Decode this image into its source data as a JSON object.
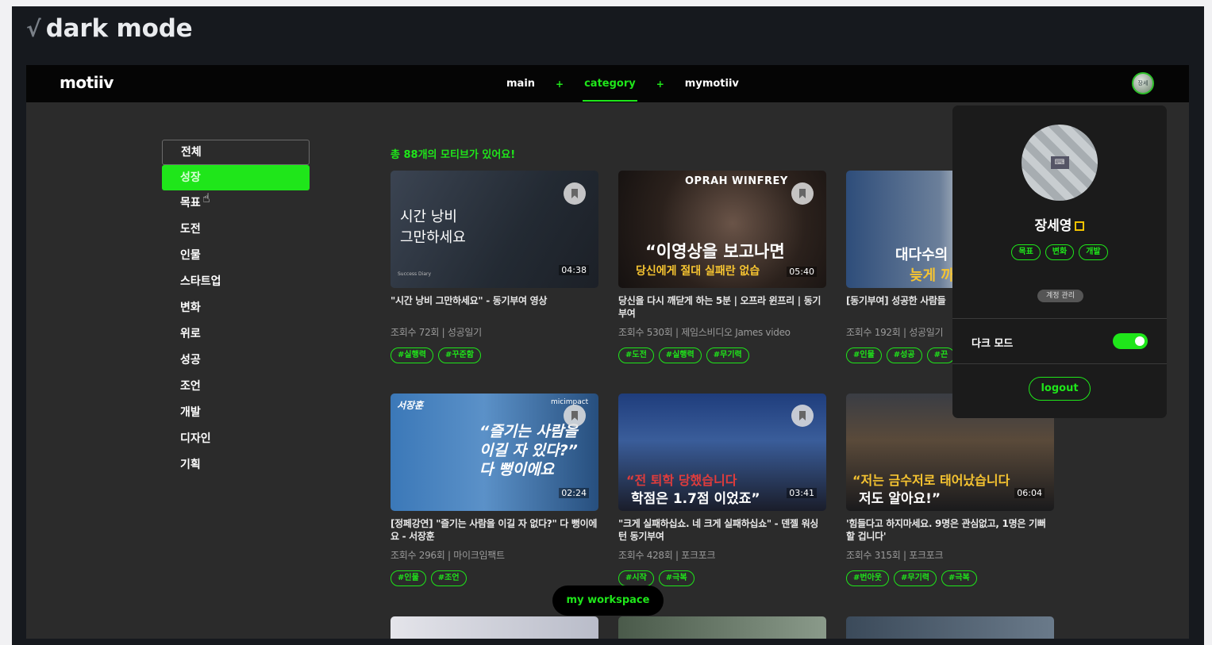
{
  "heading": {
    "check": "√",
    "title": "dark mode"
  },
  "logo": "motiiv",
  "nav": {
    "items": [
      "main",
      "category",
      "mymotiiv"
    ],
    "separator": "+",
    "active": "category"
  },
  "avatar_small": "장세",
  "sidebar": {
    "categories": [
      "전체",
      "성장",
      "목표",
      "도전",
      "인물",
      "스타트업",
      "변화",
      "위로",
      "성공",
      "조언",
      "개발",
      "디자인",
      "기획"
    ],
    "outlined": "전체",
    "selected": "성장"
  },
  "total_text": "총 88개의 모티브가 있어요!",
  "cards": [
    {
      "title": "\"시간 낭비 그만하세요\" - 동기부여 영상",
      "meta": "조회수 72회  |  성공일기",
      "tags": [
        "#실행력",
        "#꾸준함"
      ],
      "thumb_lines": [
        "시간 낭비",
        "그만하세요"
      ],
      "thumb_small": "Success Diary",
      "duration": "04:38"
    },
    {
      "title": "당신을 다시 깨닫게 하는 5분 | 오프라 윈프리 | 동기부여",
      "meta": "조회수 530회  |  제임스비디오 James video",
      "tags": [
        "#도전",
        "#실행력",
        "#무기력"
      ],
      "thumb_lines": [
        "OPRAH WINFREY",
        "“이영상을 보고나면",
        "당신에게 절대 실패란 없습"
      ],
      "duration": "05:40"
    },
    {
      "title": "[동기부여] 성공한 사람들",
      "meta": "조회수 192회  |  성공일기",
      "tags": [
        "#인물",
        "#성공",
        "#끈"
      ],
      "thumb_lines": [
        "대다수의",
        "늦게 까"
      ],
      "duration": ""
    },
    {
      "title": "[정페강연] \"즐기는 사람을 이길 자 없다?\" 다 뻥이에요 - 서장훈",
      "meta": "조회수 296회  |  마이크임팩트",
      "tags": [
        "#인물",
        "#조언"
      ],
      "thumb_lines": [
        "서장훈",
        "“즐기는 사람을",
        "이길 자 있다?”",
        "다 뻥이에요"
      ],
      "thumb_small": "micimpact",
      "duration": "02:24"
    },
    {
      "title": "\"크게 실패하십쇼. 네 크게 실패하십쇼\" - 덴젤 워싱턴 동기부여",
      "meta": "조회수 428회  |  포크포크",
      "tags": [
        "#시작",
        "#극복"
      ],
      "thumb_lines": [
        "“전 퇴학 당했습니다",
        "학점은 1.7점 이었죠”"
      ],
      "duration": "03:41"
    },
    {
      "title": "'힘들다고 하지마세요. 9명은 관심없고, 1명은 기뻐할 겁니다'",
      "meta": "조회수 315회  |  포크포크",
      "tags": [
        "#번아웃",
        "#무기력",
        "#극복"
      ],
      "thumb_lines": [
        "“저는 금수저로 태어났습니다",
        "저도 알아요!”"
      ],
      "duration": "06:04"
    }
  ],
  "profile": {
    "name": "장세영",
    "tags": [
      "목표",
      "변화",
      "개발"
    ],
    "manage": "계정 관리",
    "dark_mode_label": "다크 모드",
    "dark_mode_on": true,
    "logout": "logout"
  },
  "workspace_button": "my workspace",
  "colors": {
    "accent": "#1fe61a",
    "background": "#2b2b2b",
    "topbar": "#050505"
  }
}
